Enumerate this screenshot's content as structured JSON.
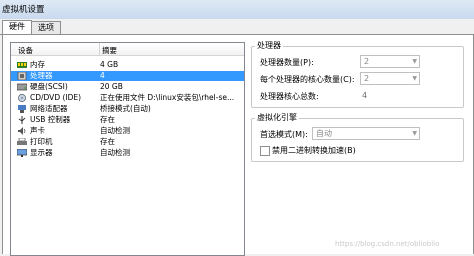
{
  "window": {
    "title": "虚拟机设置"
  },
  "tabs": [
    {
      "label": "硬件",
      "active": true
    },
    {
      "label": "选项",
      "active": false
    }
  ],
  "device_list": {
    "headers": {
      "device": "设备",
      "summary": "摘要"
    },
    "rows": [
      {
        "icon": "memory-icon",
        "name": "内存",
        "summary": "4 GB",
        "selected": false
      },
      {
        "icon": "processor-icon",
        "name": "处理器",
        "summary": "4",
        "selected": true
      },
      {
        "icon": "harddisk-icon",
        "name": "硬盘(SCSI)",
        "summary": "20 GB",
        "selected": false
      },
      {
        "icon": "cd-dvd-icon",
        "name": "CD/DVD (IDE)",
        "summary": "正在使用文件 D:\\linux安装包\\rhel-se...",
        "selected": false
      },
      {
        "icon": "network-adapter-icon",
        "name": "网络适配器",
        "summary": "桥接模式(自动)",
        "selected": false
      },
      {
        "icon": "usb-icon",
        "name": "USB 控制器",
        "summary": "存在",
        "selected": false
      },
      {
        "icon": "sound-card-icon",
        "name": "声卡",
        "summary": "自动检测",
        "selected": false
      },
      {
        "icon": "printer-icon",
        "name": "打印机",
        "summary": "存在",
        "selected": false
      },
      {
        "icon": "display-icon",
        "name": "显示器",
        "summary": "自动检测",
        "selected": false
      }
    ]
  },
  "processor_group": {
    "title": "处理器",
    "processor_count_label": "处理器数量(P):",
    "processor_count_value": "2",
    "cores_label": "每个处理器的核心数量(C):",
    "cores_value": "2",
    "total_cores_label": "处理器核心总数:",
    "total_cores_value": "4"
  },
  "virtualization_group": {
    "title": "虚拟化引擎",
    "mode_label": "首选模式(M):",
    "mode_value": "自动",
    "binary_translation_label": "禁用二进制转换加速(B)",
    "binary_translation_checked": false
  },
  "watermark": "https://blog.csdn.net/oblioblio",
  "colors": {
    "selection": "#3399ff",
    "title_bar": "#c9d9ee"
  }
}
